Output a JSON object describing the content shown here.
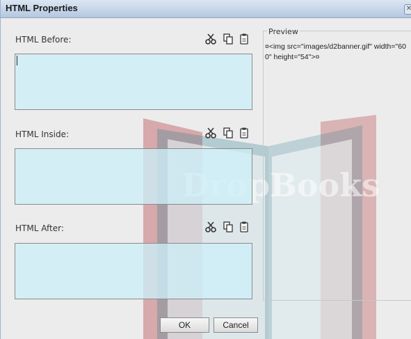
{
  "dialog": {
    "title": "HTML Properties",
    "close_glyph": "✕"
  },
  "sections": [
    {
      "label": "HTML Before:",
      "value": ""
    },
    {
      "label": "HTML Inside:",
      "value": ""
    },
    {
      "label": "HTML After:",
      "value": ""
    }
  ],
  "tool_icons": [
    "cut-icon",
    "copy-icon",
    "paste-icon"
  ],
  "preview": {
    "legend": "Preview",
    "code": "¤<img src=\"images/d2banner.gif\" width=\"600\" height=\"54\">¤"
  },
  "buttons": {
    "ok": "OK",
    "cancel": "Cancel"
  },
  "watermark": {
    "text": "DropBooks"
  },
  "colors": {
    "textbox_bg": "#cdeef7",
    "dialog_bg": "#ececec",
    "titlebar": "#b5c8e0",
    "watermark_red": "#b12e35",
    "watermark_blue": "#2f7f93"
  }
}
